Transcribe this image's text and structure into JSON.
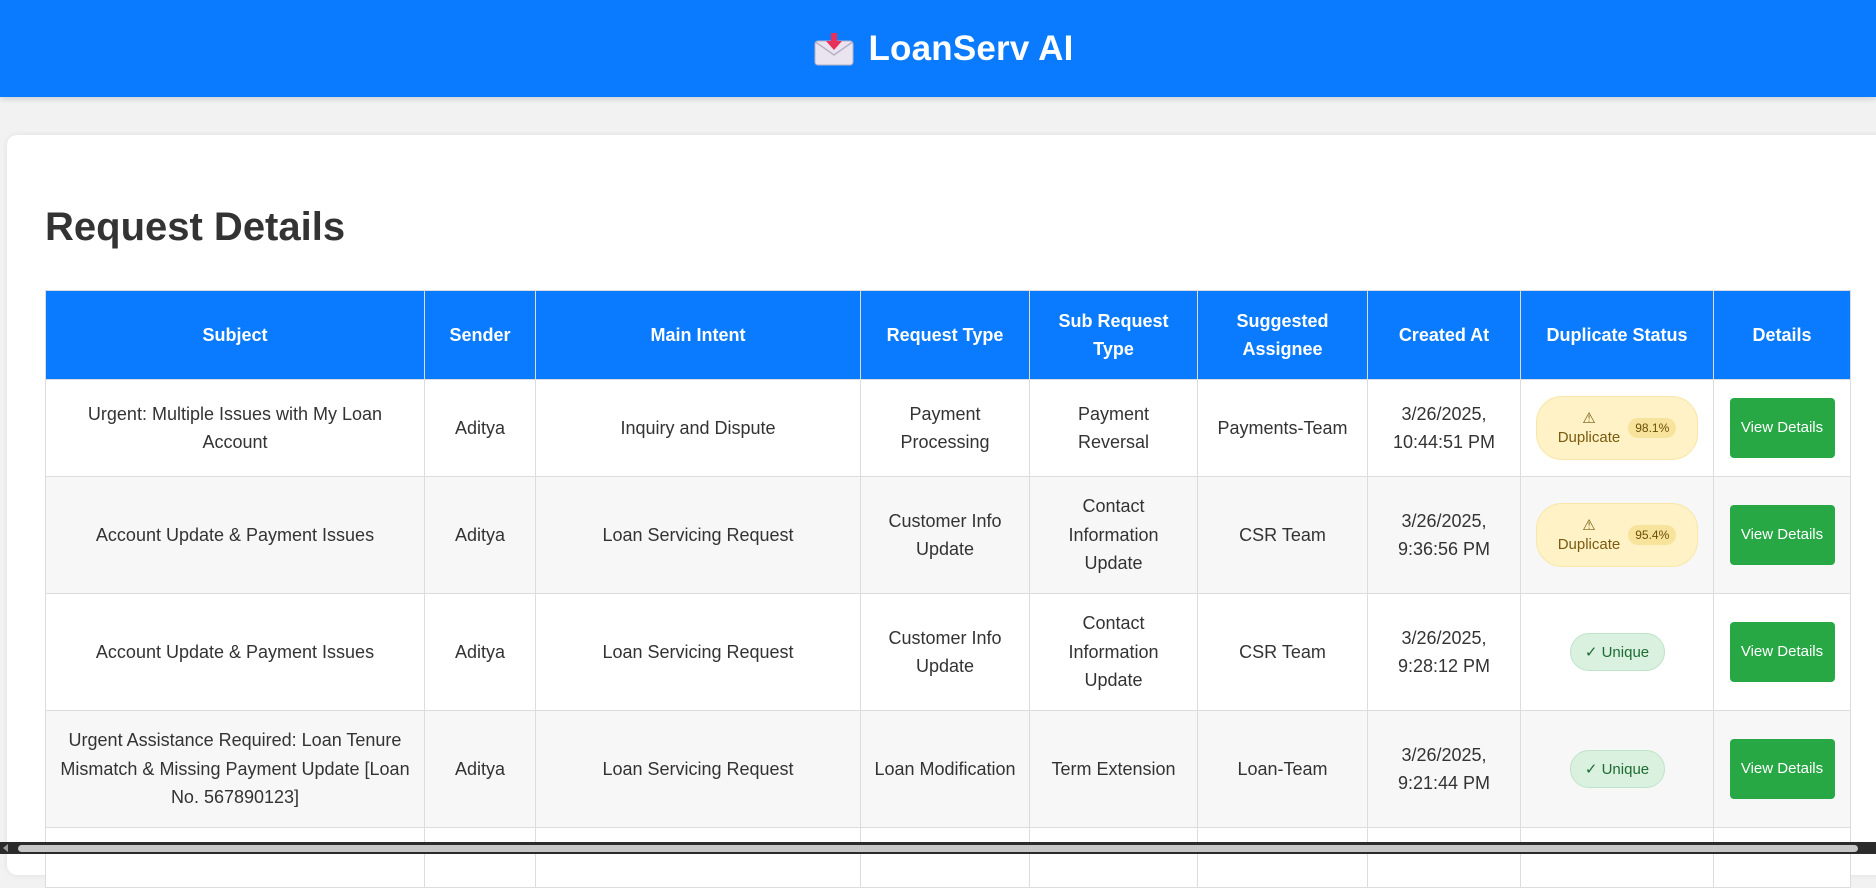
{
  "header": {
    "title": "LoanServ AI",
    "icon": "incoming-envelope-icon",
    "background_color": "#0a7bff"
  },
  "page": {
    "title": "Request Details"
  },
  "table": {
    "columns": [
      "Subject",
      "Sender",
      "Main Intent",
      "Request Type",
      "Sub Request Type",
      "Suggested Assignee",
      "Created At",
      "Duplicate Status",
      "Details"
    ],
    "rows": [
      {
        "subject": "Urgent: Multiple Issues with My Loan Account",
        "sender": "Aditya",
        "main_intent": "Inquiry and Dispute",
        "request_type": "Payment Processing",
        "sub_request_type": "Payment Reversal",
        "assignee": "Payments-Team",
        "created_at": "3/26/2025, 10:44:51 PM",
        "duplicate": true,
        "status_icon": "⚠",
        "status_label": "Duplicate",
        "score": "98.1%",
        "details_label": "View Details"
      },
      {
        "subject": "Account Update & Payment Issues",
        "sender": "Aditya",
        "main_intent": "Loan Servicing Request",
        "request_type": "Customer Info Update",
        "sub_request_type": "Contact Information Update",
        "assignee": "CSR Team",
        "created_at": "3/26/2025, 9:36:56 PM",
        "duplicate": true,
        "status_icon": "⚠",
        "status_label": "Duplicate",
        "score": "95.4%",
        "details_label": "View Details"
      },
      {
        "subject": "Account Update & Payment Issues",
        "sender": "Aditya",
        "main_intent": "Loan Servicing Request",
        "request_type": "Customer Info Update",
        "sub_request_type": "Contact Information Update",
        "assignee": "CSR Team",
        "created_at": "3/26/2025, 9:28:12 PM",
        "duplicate": false,
        "status_label": "✓ Unique",
        "details_label": "View Details"
      },
      {
        "subject": "Urgent Assistance Required: Loan Tenure Mismatch & Missing Payment Update [Loan No. 567890123]",
        "sender": "Aditya",
        "main_intent": "Loan Servicing Request",
        "request_type": "Loan Modification",
        "sub_request_type": "Term Extension",
        "assignee": "Loan-Team",
        "created_at": "3/26/2025, 9:21:44 PM",
        "duplicate": false,
        "status_label": "✓ Unique",
        "details_label": "View Details"
      }
    ]
  },
  "colors": {
    "header_blue": "#0a7bff",
    "button_green": "#28a745",
    "duplicate_bg": "#fff2c6",
    "unique_bg": "#d9f1de"
  }
}
